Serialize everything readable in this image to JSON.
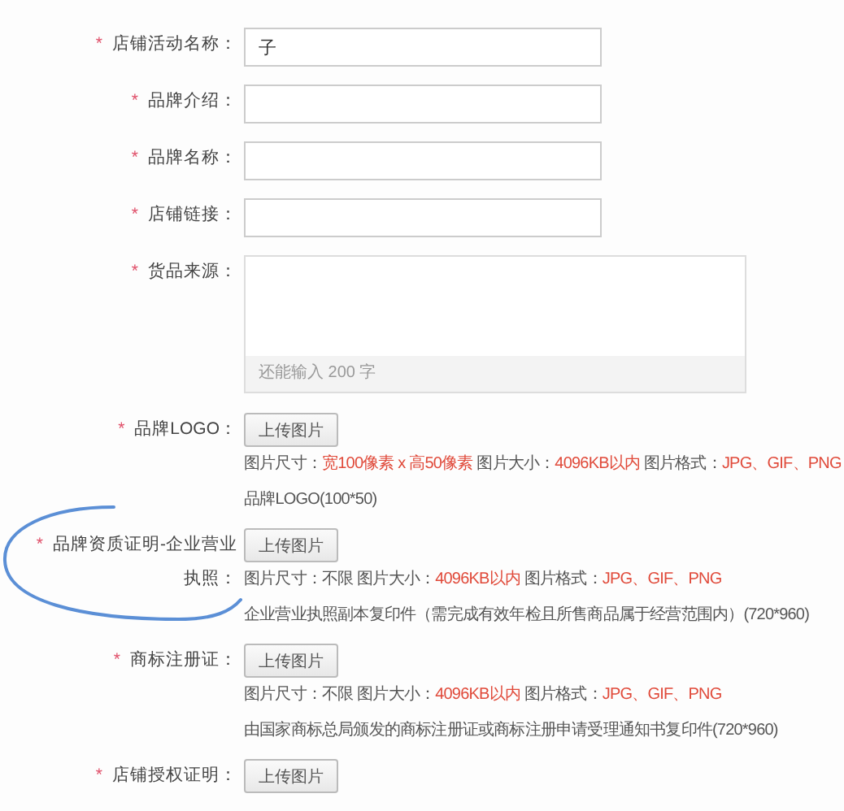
{
  "fields": [
    {
      "kind": "text",
      "mark": "*",
      "label": "店铺活动名称：",
      "value": "子"
    },
    {
      "kind": "text",
      "mark": "*",
      "label": "品牌介绍："
    },
    {
      "kind": "text",
      "mark": "*",
      "label": "品牌名称："
    },
    {
      "kind": "text",
      "mark": "*",
      "label": "店铺链接："
    },
    {
      "kind": "textarea",
      "mark": "*",
      "label": "货品来源：",
      "counter": "还能输入 200 字"
    },
    {
      "kind": "upload",
      "mark": "*",
      "label": "品牌LOGO：",
      "button": "上传图片",
      "spec": [
        {
          "text": "图片尺寸：",
          "highlight": false
        },
        {
          "text": "宽100像素 x 高50像素",
          "highlight": true
        },
        {
          "text": " 图片大小：",
          "highlight": false
        },
        {
          "text": "4096KB以内",
          "highlight": true
        },
        {
          "text": " 图片格式：",
          "highlight": false
        },
        {
          "text": "JPG、GIF、PNG",
          "highlight": true
        }
      ],
      "note": "品牌LOGO(100*50)"
    },
    {
      "kind": "upload",
      "mark": "*",
      "label": "品牌资质证明-企业营业执照：",
      "button": "上传图片",
      "spec": [
        {
          "text": "图片尺寸：不限 图片大小：",
          "highlight": false
        },
        {
          "text": "4096KB以内",
          "highlight": true
        },
        {
          "text": " 图片格式：",
          "highlight": false
        },
        {
          "text": "JPG、GIF、PNG",
          "highlight": true
        }
      ],
      "note": "企业营业执照副本复印件（需完成有效年检且所售商品属于经营范围内）(720*960)"
    },
    {
      "kind": "upload",
      "mark": "*",
      "label": "商标注册证：",
      "button": "上传图片",
      "spec": [
        {
          "text": "图片尺寸：不限 图片大小：",
          "highlight": false
        },
        {
          "text": "4096KB以内",
          "highlight": true
        },
        {
          "text": " 图片格式：",
          "highlight": false
        },
        {
          "text": "JPG、GIF、PNG",
          "highlight": true
        }
      ],
      "note": "由国家商标总局颁发的商标注册证或商标注册申请受理通知书复印件(720*960)"
    },
    {
      "kind": "upload",
      "mark": "*",
      "label": "店铺授权证明：",
      "button": "上传图片"
    }
  ]
}
